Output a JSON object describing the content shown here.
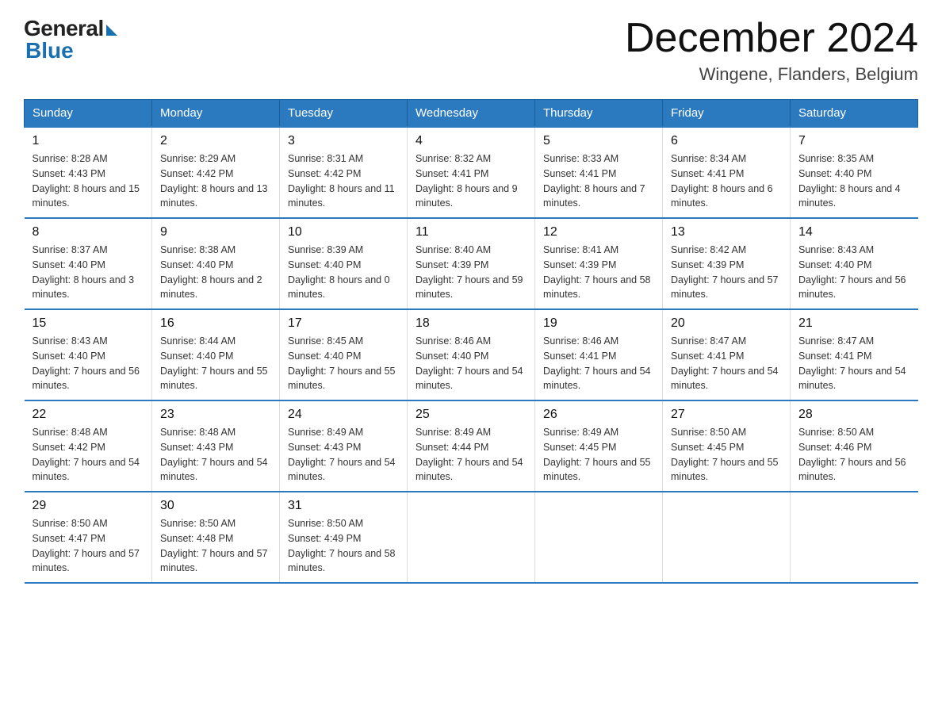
{
  "header": {
    "logo_general": "General",
    "logo_blue": "Blue",
    "month_title": "December 2024",
    "subtitle": "Wingene, Flanders, Belgium"
  },
  "days_of_week": [
    "Sunday",
    "Monday",
    "Tuesday",
    "Wednesday",
    "Thursday",
    "Friday",
    "Saturday"
  ],
  "weeks": [
    [
      {
        "day": "1",
        "sunrise": "8:28 AM",
        "sunset": "4:43 PM",
        "daylight": "8 hours and 15 minutes."
      },
      {
        "day": "2",
        "sunrise": "8:29 AM",
        "sunset": "4:42 PM",
        "daylight": "8 hours and 13 minutes."
      },
      {
        "day": "3",
        "sunrise": "8:31 AM",
        "sunset": "4:42 PM",
        "daylight": "8 hours and 11 minutes."
      },
      {
        "day": "4",
        "sunrise": "8:32 AM",
        "sunset": "4:41 PM",
        "daylight": "8 hours and 9 minutes."
      },
      {
        "day": "5",
        "sunrise": "8:33 AM",
        "sunset": "4:41 PM",
        "daylight": "8 hours and 7 minutes."
      },
      {
        "day": "6",
        "sunrise": "8:34 AM",
        "sunset": "4:41 PM",
        "daylight": "8 hours and 6 minutes."
      },
      {
        "day": "7",
        "sunrise": "8:35 AM",
        "sunset": "4:40 PM",
        "daylight": "8 hours and 4 minutes."
      }
    ],
    [
      {
        "day": "8",
        "sunrise": "8:37 AM",
        "sunset": "4:40 PM",
        "daylight": "8 hours and 3 minutes."
      },
      {
        "day": "9",
        "sunrise": "8:38 AM",
        "sunset": "4:40 PM",
        "daylight": "8 hours and 2 minutes."
      },
      {
        "day": "10",
        "sunrise": "8:39 AM",
        "sunset": "4:40 PM",
        "daylight": "8 hours and 0 minutes."
      },
      {
        "day": "11",
        "sunrise": "8:40 AM",
        "sunset": "4:39 PM",
        "daylight": "7 hours and 59 minutes."
      },
      {
        "day": "12",
        "sunrise": "8:41 AM",
        "sunset": "4:39 PM",
        "daylight": "7 hours and 58 minutes."
      },
      {
        "day": "13",
        "sunrise": "8:42 AM",
        "sunset": "4:39 PM",
        "daylight": "7 hours and 57 minutes."
      },
      {
        "day": "14",
        "sunrise": "8:43 AM",
        "sunset": "4:40 PM",
        "daylight": "7 hours and 56 minutes."
      }
    ],
    [
      {
        "day": "15",
        "sunrise": "8:43 AM",
        "sunset": "4:40 PM",
        "daylight": "7 hours and 56 minutes."
      },
      {
        "day": "16",
        "sunrise": "8:44 AM",
        "sunset": "4:40 PM",
        "daylight": "7 hours and 55 minutes."
      },
      {
        "day": "17",
        "sunrise": "8:45 AM",
        "sunset": "4:40 PM",
        "daylight": "7 hours and 55 minutes."
      },
      {
        "day": "18",
        "sunrise": "8:46 AM",
        "sunset": "4:40 PM",
        "daylight": "7 hours and 54 minutes."
      },
      {
        "day": "19",
        "sunrise": "8:46 AM",
        "sunset": "4:41 PM",
        "daylight": "7 hours and 54 minutes."
      },
      {
        "day": "20",
        "sunrise": "8:47 AM",
        "sunset": "4:41 PM",
        "daylight": "7 hours and 54 minutes."
      },
      {
        "day": "21",
        "sunrise": "8:47 AM",
        "sunset": "4:41 PM",
        "daylight": "7 hours and 54 minutes."
      }
    ],
    [
      {
        "day": "22",
        "sunrise": "8:48 AM",
        "sunset": "4:42 PM",
        "daylight": "7 hours and 54 minutes."
      },
      {
        "day": "23",
        "sunrise": "8:48 AM",
        "sunset": "4:43 PM",
        "daylight": "7 hours and 54 minutes."
      },
      {
        "day": "24",
        "sunrise": "8:49 AM",
        "sunset": "4:43 PM",
        "daylight": "7 hours and 54 minutes."
      },
      {
        "day": "25",
        "sunrise": "8:49 AM",
        "sunset": "4:44 PM",
        "daylight": "7 hours and 54 minutes."
      },
      {
        "day": "26",
        "sunrise": "8:49 AM",
        "sunset": "4:45 PM",
        "daylight": "7 hours and 55 minutes."
      },
      {
        "day": "27",
        "sunrise": "8:50 AM",
        "sunset": "4:45 PM",
        "daylight": "7 hours and 55 minutes."
      },
      {
        "day": "28",
        "sunrise": "8:50 AM",
        "sunset": "4:46 PM",
        "daylight": "7 hours and 56 minutes."
      }
    ],
    [
      {
        "day": "29",
        "sunrise": "8:50 AM",
        "sunset": "4:47 PM",
        "daylight": "7 hours and 57 minutes."
      },
      {
        "day": "30",
        "sunrise": "8:50 AM",
        "sunset": "4:48 PM",
        "daylight": "7 hours and 57 minutes."
      },
      {
        "day": "31",
        "sunrise": "8:50 AM",
        "sunset": "4:49 PM",
        "daylight": "7 hours and 58 minutes."
      },
      null,
      null,
      null,
      null
    ]
  ]
}
